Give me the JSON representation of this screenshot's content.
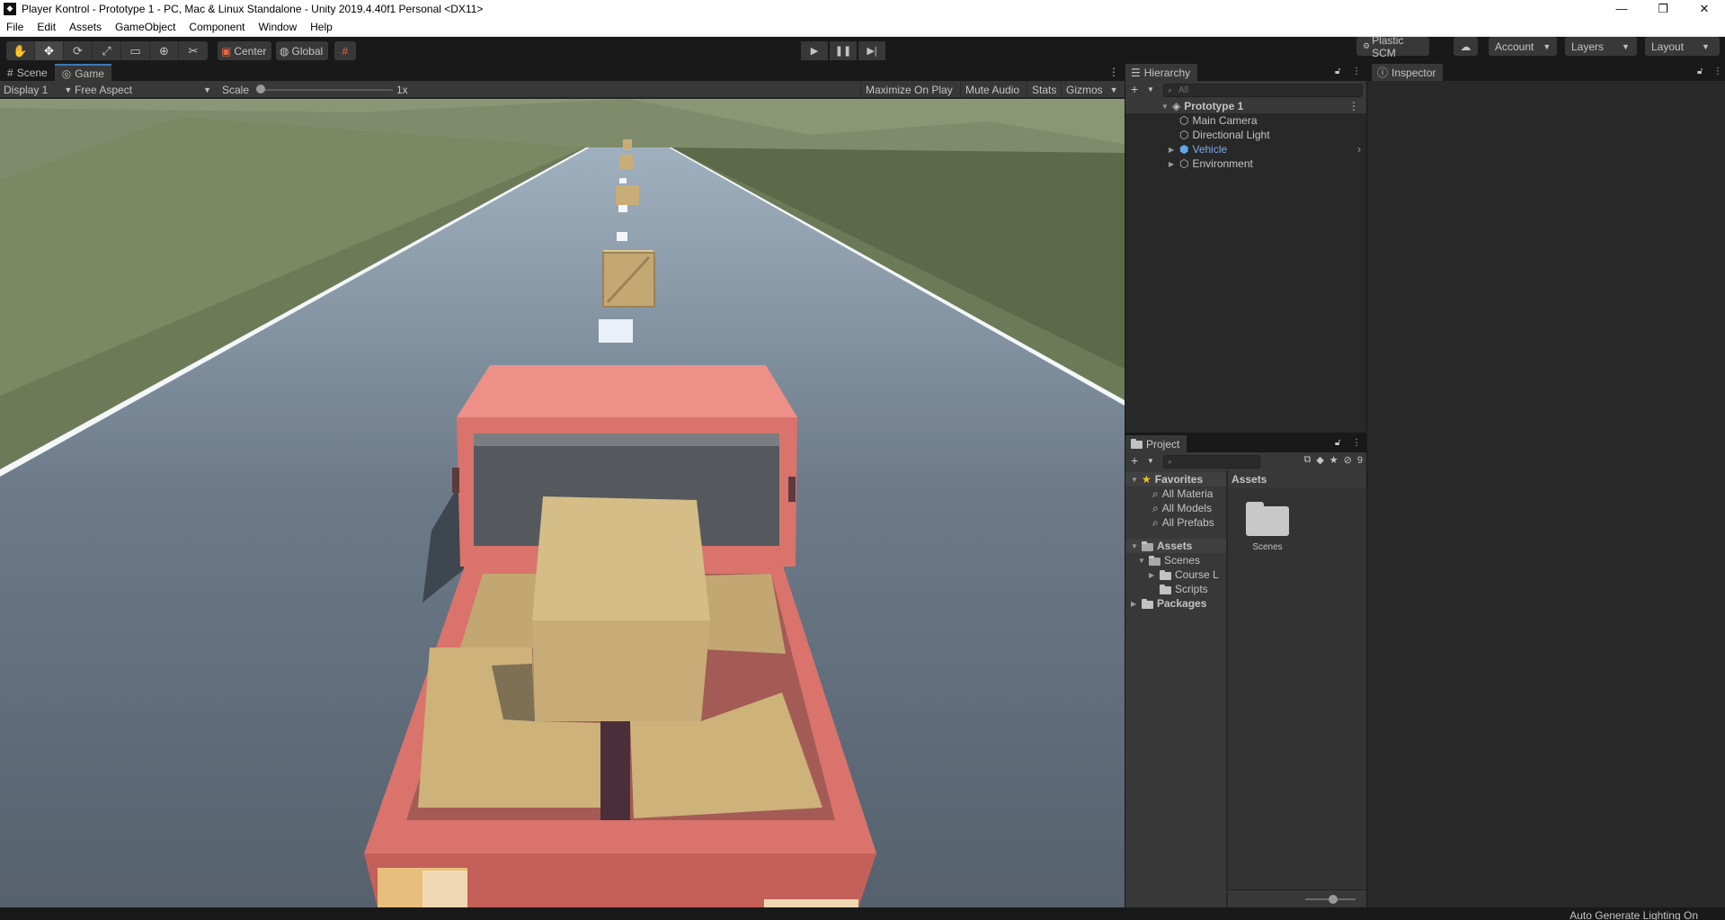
{
  "window": {
    "title": "Player Kontrol - Prototype 1 - PC, Mac & Linux Standalone - Unity 2019.4.40f1 Personal <DX11>",
    "minimize": "—",
    "maximize": "❐",
    "close": "✕"
  },
  "menu": [
    "File",
    "Edit",
    "Assets",
    "GameObject",
    "Component",
    "Window",
    "Help"
  ],
  "toolbar": {
    "tools": [
      "hand-tool",
      "move-tool",
      "rotate-tool",
      "scale-tool",
      "rect-tool",
      "transform-tool",
      "custom-tool"
    ],
    "active_tool": "move-tool",
    "pivot_mode": "Center",
    "pivot_rotation": "Global",
    "plastic_scm": "Plastic SCM",
    "account": "Account",
    "layers": "Layers",
    "layout": "Layout"
  },
  "game_panel": {
    "tabs": [
      {
        "label": "Scene",
        "active": false
      },
      {
        "label": "Game",
        "active": true
      }
    ],
    "display": "Display 1",
    "aspect": "Free Aspect",
    "scale_label": "Scale",
    "scale_value": "1x",
    "maximize_on_play": "Maximize On Play",
    "mute_audio": "Mute Audio",
    "stats": "Stats",
    "gizmos": "Gizmos"
  },
  "hierarchy": {
    "tab": "Hierarchy",
    "search_placeholder": "All",
    "scene": "Prototype 1",
    "items": [
      {
        "label": "Main Camera",
        "expandable": false,
        "prefab": false
      },
      {
        "label": "Directional Light",
        "expandable": false,
        "prefab": false
      },
      {
        "label": "Vehicle",
        "expandable": true,
        "prefab": true
      },
      {
        "label": "Environment",
        "expandable": true,
        "prefab": false
      }
    ]
  },
  "inspector": {
    "tab": "Inspector"
  },
  "project": {
    "tab": "Project",
    "hidden_count": "9",
    "favorites": {
      "label": "Favorites",
      "items": [
        "All Materia",
        "All Models",
        "All Prefabs"
      ]
    },
    "assets": {
      "label": "Assets",
      "children": [
        {
          "label": "Scenes",
          "children": [
            "Course L",
            "Scripts"
          ]
        }
      ]
    },
    "packages": "Packages",
    "right_header": "Assets",
    "right_items": [
      "Scenes"
    ]
  },
  "status": {
    "text": "Auto Generate Lighting On"
  },
  "colors": {
    "editor_bg": "#191919",
    "panel_bg": "#282828",
    "accent_blue": "#3a79bb",
    "truck_red": "#d9736b",
    "crate_tan": "#cdb27a",
    "road": "#5d6a7a",
    "grass": "#6b7a5a"
  }
}
